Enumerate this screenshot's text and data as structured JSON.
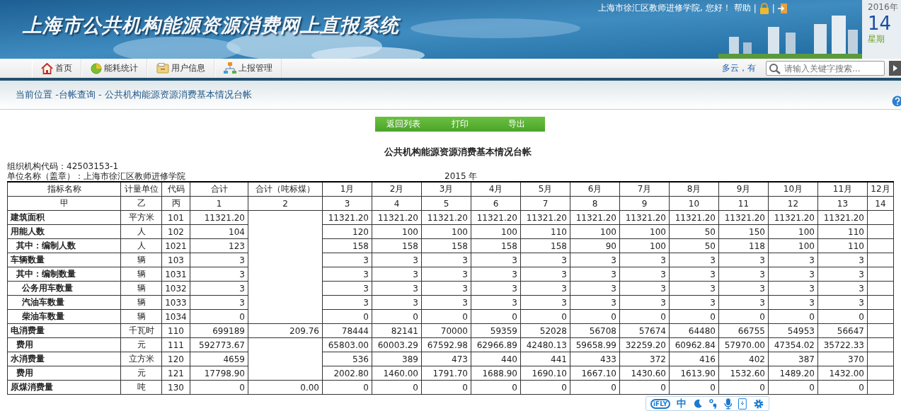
{
  "header": {
    "title": "上海市公共机构能源资源消费网上直报系统",
    "greeting": "上海市徐汇区教师进修学院, 您好！",
    "help": "帮助",
    "separator": "|",
    "date": {
      "year": "2016年",
      "day": "14",
      "weekday": "星期"
    }
  },
  "nav": {
    "items": [
      {
        "label": "首页"
      },
      {
        "label": "能耗统计"
      },
      {
        "label": "用户信息"
      },
      {
        "label": "上报管理"
      }
    ],
    "weather": "多云，有",
    "search": {
      "placeholder": "请输入关键字搜索..."
    }
  },
  "breadcrumb": "当前位置 -台帐查询 - 公共机构能源资源消费基本情况台帐",
  "actions": [
    "返回列表",
    "打印",
    "导出"
  ],
  "report": {
    "title": "公共机构能源资源消费基本情况台帐",
    "org_code": "组织机构代码：42503153-1",
    "unit_name": "单位名称（盖章）：上海市徐汇区教师进修学院",
    "year": "2015 年",
    "columns": [
      "指标名称",
      "计量单位",
      "代码",
      "合计",
      "合计（吨标煤）",
      "1月",
      "2月",
      "3月",
      "4月",
      "5月",
      "6月",
      "7月",
      "8月",
      "9月",
      "10月",
      "11月",
      "12月"
    ],
    "column_codes": [
      "甲",
      "乙",
      "丙",
      "1",
      "2",
      "3",
      "4",
      "5",
      "6",
      "7",
      "8",
      "9",
      "10",
      "11",
      "12",
      "13",
      "14"
    ],
    "rows": [
      {
        "name": "建筑面积",
        "unit": "平方米",
        "code": "101",
        "total": "11321.20",
        "months": [
          "11321.20",
          "11321.20",
          "11321.20",
          "11321.20",
          "11321.20",
          "11321.20",
          "11321.20",
          "11321.20",
          "11321.20",
          "11321.20",
          "11321.20"
        ]
      },
      {
        "name": "用能人数",
        "unit": "人",
        "code": "102",
        "total": "104",
        "months": [
          "120",
          "100",
          "100",
          "100",
          "110",
          "100",
          "100",
          "50",
          "150",
          "100",
          "110"
        ],
        "children": [
          {
            "name": "其中：编制人数",
            "unit": "人",
            "code": "1021",
            "total": "123",
            "months": [
              "158",
              "158",
              "158",
              "158",
              "158",
              "90",
              "100",
              "50",
              "118",
              "100",
              "110"
            ]
          }
        ]
      },
      {
        "name": "车辆数量",
        "unit": "辆",
        "code": "103",
        "total": "3",
        "months": [
          "3",
          "3",
          "3",
          "3",
          "3",
          "3",
          "3",
          "3",
          "3",
          "3",
          "3"
        ],
        "children": [
          {
            "name": "其中：编制数量",
            "unit": "辆",
            "code": "1031",
            "total": "3",
            "months": [
              "3",
              "3",
              "3",
              "3",
              "3",
              "3",
              "3",
              "3",
              "3",
              "3",
              "3"
            ],
            "children": [
              {
                "name": "公务用车数量",
                "unit": "辆",
                "code": "1032",
                "total": "3",
                "months": [
                  "3",
                  "3",
                  "3",
                  "3",
                  "3",
                  "3",
                  "3",
                  "3",
                  "3",
                  "3",
                  "3"
                ]
              },
              {
                "name": "汽油车数量",
                "unit": "辆",
                "code": "1033",
                "total": "3",
                "months": [
                  "3",
                  "3",
                  "3",
                  "3",
                  "3",
                  "3",
                  "3",
                  "3",
                  "3",
                  "3",
                  "3"
                ]
              },
              {
                "name": "柴油车数量",
                "unit": "辆",
                "code": "1034",
                "total": "0",
                "months": [
                  "0",
                  "0",
                  "0",
                  "0",
                  "0",
                  "0",
                  "0",
                  "0",
                  "0",
                  "0",
                  "0"
                ]
              }
            ]
          }
        ]
      },
      {
        "name": "电消费量",
        "unit": "千瓦时",
        "code": "110",
        "total": "699189",
        "total_tce": "209.76",
        "months": [
          "78444",
          "82141",
          "70000",
          "59359",
          "52028",
          "56708",
          "57674",
          "64480",
          "66755",
          "54953",
          "56647"
        ],
        "children": [
          {
            "name": "费用",
            "unit": "元",
            "code": "111",
            "total": "592773.67",
            "months": [
              "65803.00",
              "60003.29",
              "67592.98",
              "62966.89",
              "42480.13",
              "59658.99",
              "32259.20",
              "60962.84",
              "57970.00",
              "47354.02",
              "35722.33"
            ]
          }
        ]
      },
      {
        "name": "水消费量",
        "unit": "立方米",
        "code": "120",
        "total": "4659",
        "months": [
          "536",
          "389",
          "473",
          "440",
          "441",
          "433",
          "372",
          "416",
          "402",
          "387",
          "370"
        ],
        "children": [
          {
            "name": "费用",
            "unit": "元",
            "code": "121",
            "total": "17798.90",
            "months": [
              "2002.80",
              "1460.00",
              "1791.70",
              "1688.90",
              "1690.10",
              "1667.10",
              "1430.60",
              "1613.90",
              "1532.60",
              "1489.20",
              "1432.00"
            ]
          }
        ]
      },
      {
        "name": "原煤消费量",
        "unit": "吨",
        "code": "130",
        "total": "0",
        "total_tce": "0.00",
        "months": [
          "0",
          "0",
          "0",
          "0",
          "0",
          "0",
          "0",
          "0",
          "0",
          "0",
          "0"
        ]
      }
    ]
  },
  "ime_toolbar": {
    "logo": "iFLY",
    "mode": "中"
  }
}
